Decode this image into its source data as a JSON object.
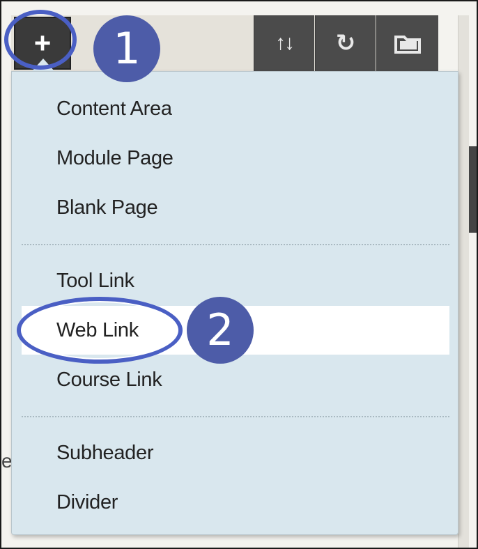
{
  "toolbar": {
    "add_button_label": "+",
    "sort_icon": "sort-icon",
    "refresh_icon": "refresh-icon",
    "folder_icon": "folder-icon"
  },
  "callouts": {
    "step_1": "1",
    "step_2": "2"
  },
  "menu": {
    "groups": [
      [
        "Content Area",
        "Module Page",
        "Blank Page"
      ],
      [
        "Tool Link",
        "Web Link",
        "Course Link"
      ],
      [
        "Subheader",
        "Divider"
      ]
    ],
    "highlighted_item": "Web Link"
  },
  "colors": {
    "menu_bg": "#d9e7ee",
    "callout_blue": "#4d5ca8",
    "ring_blue": "#4a5fc4",
    "toolbar_dark": "#4b4b4b"
  }
}
